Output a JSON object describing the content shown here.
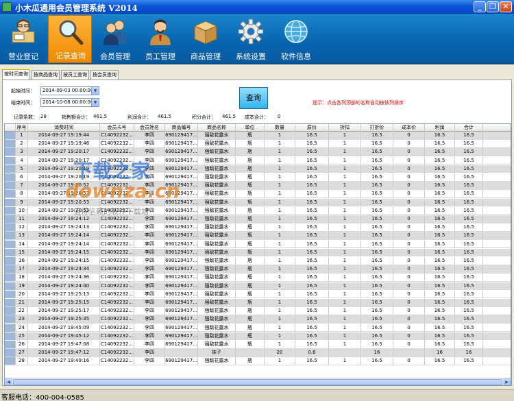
{
  "window": {
    "title": "小木瓜通用会员管理系统  V2014",
    "min_icon": "_",
    "max_icon": "❐",
    "close_icon": "✕"
  },
  "toolbar": {
    "items": [
      {
        "label": "营业登记",
        "icon": "cashier-person-icon"
      },
      {
        "label": "记录查询",
        "icon": "magnifier-icon"
      },
      {
        "label": "会员管理",
        "icon": "members-icon"
      },
      {
        "label": "员工管理",
        "icon": "employee-icon"
      },
      {
        "label": "商品管理",
        "icon": "box-icon"
      },
      {
        "label": "系统设置",
        "icon": "gear-icon"
      },
      {
        "label": "软件信息",
        "icon": "globe-icon"
      }
    ],
    "active_index": 1
  },
  "tabs": [
    "按时间查询",
    "按商品查询",
    "按员工查询",
    "按会员查询"
  ],
  "filter": {
    "start_label": "起始时间：",
    "start_value": "2014-09-03 00:00:00",
    "end_label": "结束时间：",
    "end_value": "2014-10-08 00:00:00",
    "query_button": "查询",
    "hint": "提示：点击各列顶部的名称自动按该列排序"
  },
  "summary": {
    "count_label": "记录条数：",
    "count_value": "28",
    "sales_label": "销售额合计：",
    "sales_value": "461.5",
    "profit_label": "利润合计：",
    "profit_value": "461.5",
    "points_label": "积分合计：",
    "points_value": "461.5",
    "cost_label": "成本合计：",
    "cost_value": "0"
  },
  "table": {
    "columns": [
      "序号",
      "消费时间",
      "会员卡号",
      "会员姓名",
      "商品编号",
      "商品名称",
      "单位",
      "数量",
      "原价",
      "折扣",
      "打折价",
      "成本价",
      "利润",
      "合计"
    ],
    "rows": [
      [
        "1",
        "2014-09-27 19:19:44",
        "C14092232...",
        "李四",
        "690129417...",
        "强敌花露水",
        "瓶",
        "1",
        "16.5",
        "1",
        "16.5",
        "0",
        "16.5",
        "16.5"
      ],
      [
        "2",
        "2014-09-27 19:19:46",
        "C14092232...",
        "李四",
        "690129417...",
        "强敌花露水",
        "瓶",
        "1",
        "16.5",
        "1",
        "16.5",
        "0",
        "16.5",
        "16.5"
      ],
      [
        "3",
        "2014-09-27 19:20:17",
        "C14092232...",
        "李四",
        "690129417...",
        "强敌花露水",
        "瓶",
        "1",
        "16.5",
        "1",
        "16.5",
        "0",
        "16.5",
        "16.5"
      ],
      [
        "4",
        "2014-09-27 19:20:17",
        "C14092232...",
        "李四",
        "690129417...",
        "强敌花露水",
        "瓶",
        "1",
        "16.5",
        "1",
        "16.5",
        "0",
        "16.5",
        "16.5"
      ],
      [
        "5",
        "2014-09-27 19:20:19",
        "C14092232...",
        "李四",
        "690129417...",
        "强敌花露水",
        "瓶",
        "1",
        "16.5",
        "1",
        "16.5",
        "0",
        "16.5",
        "16.5"
      ],
      [
        "6",
        "2014-09-27 19:20:19",
        "C14092232...",
        "李四",
        "690129417...",
        "强敌花露水",
        "瓶",
        "1",
        "16.5",
        "1",
        "16.5",
        "0",
        "16.5",
        "16.5"
      ],
      [
        "7",
        "2014-09-27 19:20:52",
        "C14092232...",
        "李四",
        "690129417...",
        "强敌花露水",
        "瓶",
        "1",
        "16.5",
        "1",
        "16.5",
        "0",
        "16.5",
        "16.5"
      ],
      [
        "8",
        "2014-09-27 19:20:53",
        "C14092232...",
        "李四",
        "690129417...",
        "强敌花露水",
        "瓶",
        "1",
        "16.5",
        "1",
        "16.5",
        "0",
        "16.5",
        "16.5"
      ],
      [
        "9",
        "2014-09-27 19:20:53",
        "C14092232...",
        "李四",
        "690129417...",
        "强敌花露水",
        "瓶",
        "1",
        "16.5",
        "1",
        "16.5",
        "0",
        "16.5",
        "16.5"
      ],
      [
        "10",
        "2014-09-27 19:20:53",
        "C14092232...",
        "李四",
        "690129417...",
        "强敌花露水",
        "瓶",
        "1",
        "16.5",
        "1",
        "16.5",
        "0",
        "16.5",
        "16.5"
      ],
      [
        "11",
        "2014-09-27 19:24:12",
        "C14092232...",
        "李四",
        "690129417...",
        "强敌花露水",
        "瓶",
        "1",
        "16.5",
        "1",
        "16.5",
        "0",
        "16.5",
        "16.5"
      ],
      [
        "12",
        "2014-09-27 19:24:13",
        "C14092232...",
        "李四",
        "690129417...",
        "强敌花露水",
        "瓶",
        "1",
        "16.5",
        "1",
        "16.5",
        "0",
        "16.5",
        "16.5"
      ],
      [
        "13",
        "2014-09-27 19:24:14",
        "C14092232...",
        "李四",
        "690129417...",
        "强敌花露水",
        "瓶",
        "1",
        "16.5",
        "1",
        "16.5",
        "0",
        "16.5",
        "16.5"
      ],
      [
        "14",
        "2014-09-27 19:24:14",
        "C14092232...",
        "李四",
        "690129417...",
        "强敌花露水",
        "瓶",
        "1",
        "16.5",
        "1",
        "16.5",
        "0",
        "16.5",
        "16.5"
      ],
      [
        "15",
        "2014-09-27 19:24:15",
        "C14092232...",
        "李四",
        "690129417...",
        "强敌花露水",
        "瓶",
        "1",
        "16.5",
        "1",
        "16.5",
        "0",
        "16.5",
        "16.5"
      ],
      [
        "16",
        "2014-09-27 19:24:15",
        "C14092232...",
        "李四",
        "690129417...",
        "强敌花露水",
        "瓶",
        "1",
        "16.5",
        "1",
        "16.5",
        "0",
        "16.5",
        "16.5"
      ],
      [
        "17",
        "2014-09-27 19:24:34",
        "C14092232...",
        "李四",
        "690129417...",
        "强敌花露水",
        "瓶",
        "1",
        "16.5",
        "1",
        "16.5",
        "0",
        "16.5",
        "16.5"
      ],
      [
        "18",
        "2014-09-27 19:24:36",
        "C14092232...",
        "李四",
        "690129417...",
        "强敌花露水",
        "瓶",
        "1",
        "16.5",
        "1",
        "16.5",
        "0",
        "16.5",
        "16.5"
      ],
      [
        "19",
        "2014-09-27 19:24:40",
        "C14092232...",
        "李四",
        "690129417...",
        "强敌花露水",
        "瓶",
        "1",
        "16.5",
        "1",
        "16.5",
        "0",
        "16.5",
        "16.5"
      ],
      [
        "20",
        "2014-09-27 19:25:13",
        "C14092232...",
        "李四",
        "690129417...",
        "强敌花露水",
        "瓶",
        "1",
        "16.5",
        "1",
        "16.5",
        "0",
        "16.5",
        "16.5"
      ],
      [
        "21",
        "2014-09-27 19:25:15",
        "C14092232...",
        "李四",
        "690129417...",
        "强敌花露水",
        "瓶",
        "1",
        "16.5",
        "1",
        "16.5",
        "0",
        "16.5",
        "16.5"
      ],
      [
        "22",
        "2014-09-27 19:25:17",
        "C14092232...",
        "李四",
        "690129417...",
        "强敌花露水",
        "瓶",
        "1",
        "16.5",
        "1",
        "16.5",
        "0",
        "16.5",
        "16.5"
      ],
      [
        "23",
        "2014-09-27 19:25:35",
        "C14092232...",
        "李四",
        "690129417...",
        "强敌花露水",
        "瓶",
        "1",
        "16.5",
        "1",
        "16.5",
        "0",
        "16.5",
        "16.5"
      ],
      [
        "24",
        "2014-09-27 19:45:09",
        "C14092232...",
        "李四",
        "690129417...",
        "强敌花露水",
        "瓶",
        "1",
        "16.5",
        "1",
        "16.5",
        "0",
        "16.5",
        "16.5"
      ],
      [
        "25",
        "2014-09-27 19:45:12",
        "C14092232...",
        "李四",
        "690129417...",
        "强敌花露水",
        "瓶",
        "1",
        "16.5",
        "1",
        "16.5",
        "0",
        "16.5",
        "16.5"
      ],
      [
        "26",
        "2014-09-27 19:47:08",
        "C14092232...",
        "李四",
        "690129417...",
        "强敌花露水",
        "瓶",
        "1",
        "16.5",
        "1",
        "16.5",
        "0",
        "16.5",
        "16.5"
      ],
      [
        "27",
        "2014-09-27 19:47:12",
        "C14092232...",
        "李四",
        "",
        "袜子",
        "",
        "20",
        "0.8",
        "",
        "16",
        "",
        "16",
        "16"
      ],
      [
        "28",
        "2014-09-27 19:49:16",
        "C14092232...",
        "李四",
        "690129417...",
        "强敌花露水",
        "瓶",
        "1",
        "16.5",
        "1",
        "16.5",
        "0",
        "16.5",
        "16.5"
      ]
    ]
  },
  "watermark": {
    "line1": "下载之家",
    "line2": "downza.cn",
    "line3": "值得信赖的软件下载站"
  },
  "status": {
    "text": "客服电话：400-004-0585"
  }
}
